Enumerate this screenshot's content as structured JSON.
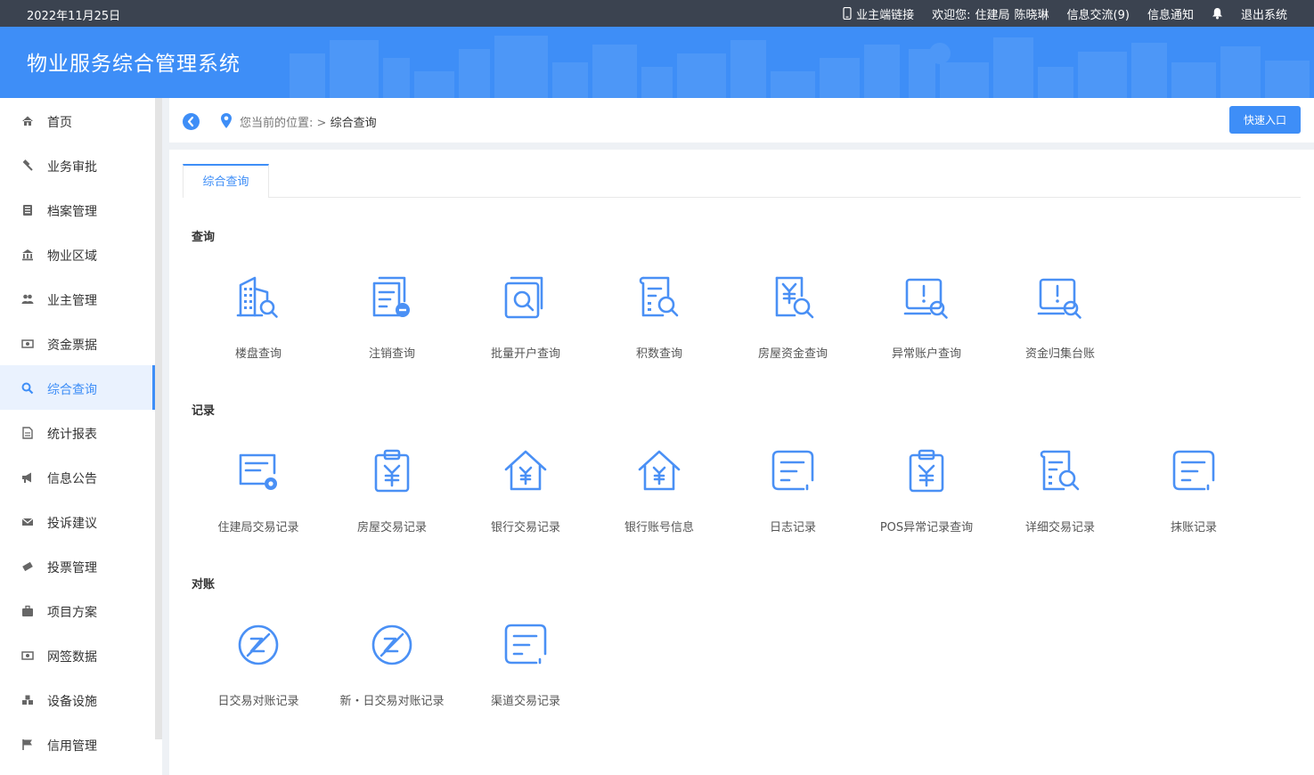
{
  "topbar": {
    "date": "2022年11月25日",
    "owner_link": "业主端链接",
    "welcome_label": "欢迎您:",
    "org": "住建局",
    "user": "陈晓琳",
    "messages": "信息交流(9)",
    "notices": "信息通知",
    "logout": "退出系统"
  },
  "banner": {
    "title": "物业服务综合管理系统"
  },
  "sidebar": {
    "items": [
      {
        "label": "首页",
        "icon": "home-icon"
      },
      {
        "label": "业务审批",
        "icon": "gavel-icon"
      },
      {
        "label": "档案管理",
        "icon": "archive-icon"
      },
      {
        "label": "物业区域",
        "icon": "bank-icon"
      },
      {
        "label": "业主管理",
        "icon": "users-icon"
      },
      {
        "label": "资金票据",
        "icon": "money-icon"
      },
      {
        "label": "综合查询",
        "icon": "search-icon"
      },
      {
        "label": "统计报表",
        "icon": "report-icon"
      },
      {
        "label": "信息公告",
        "icon": "megaphone-icon"
      },
      {
        "label": "投诉建议",
        "icon": "envelope-icon"
      },
      {
        "label": "投票管理",
        "icon": "ticket-icon"
      },
      {
        "label": "项目方案",
        "icon": "briefcase-icon"
      },
      {
        "label": "网签数据",
        "icon": "money-icon"
      },
      {
        "label": "设备设施",
        "icon": "cubes-icon"
      },
      {
        "label": "信用管理",
        "icon": "flag-icon"
      }
    ],
    "active": "综合查询"
  },
  "breadcrumb": {
    "prefix": "您当前的位置:",
    "separator": ">",
    "current": "综合查询",
    "quick_entry": "快速入口"
  },
  "tabs": {
    "active": "综合查询"
  },
  "sections": {
    "query": {
      "title": "查询",
      "tiles": [
        {
          "label": "楼盘查询",
          "icon": "building-search-icon"
        },
        {
          "label": "注销查询",
          "icon": "document-minus-icon"
        },
        {
          "label": "批量开户查询",
          "icon": "batch-search-icon"
        },
        {
          "label": "积数查询",
          "icon": "scroll-search-icon"
        },
        {
          "label": "房屋资金查询",
          "icon": "yuan-search-icon"
        },
        {
          "label": "异常账户查询",
          "icon": "alert-search-icon"
        },
        {
          "label": "资金归集台账",
          "icon": "alert-search-icon"
        }
      ]
    },
    "records": {
      "title": "记录",
      "tiles": [
        {
          "label": "住建局交易记录",
          "icon": "form-gear-icon"
        },
        {
          "label": "房屋交易记录",
          "icon": "clipboard-yuan-icon"
        },
        {
          "label": "银行交易记录",
          "icon": "house-yuan-icon"
        },
        {
          "label": "银行账号信息",
          "icon": "house-yuan-icon"
        },
        {
          "label": "日志记录",
          "icon": "note-icon"
        },
        {
          "label": "POS异常记录查询",
          "icon": "clipboard-yuan-icon"
        },
        {
          "label": "详细交易记录",
          "icon": "scroll-search-icon"
        },
        {
          "label": "抹账记录",
          "icon": "note-icon"
        }
      ]
    },
    "reconcile": {
      "title": "对账",
      "tiles": [
        {
          "label": "日交易对账记录",
          "icon": "reconcile-circle-icon"
        },
        {
          "label": "新・日交易对账记录",
          "icon": "reconcile-circle-icon"
        },
        {
          "label": "渠道交易记录",
          "icon": "note-icon"
        }
      ]
    }
  },
  "colors": {
    "accent": "#3e8ef7",
    "topbar": "#3b4350",
    "icon": "#4a90f5"
  }
}
